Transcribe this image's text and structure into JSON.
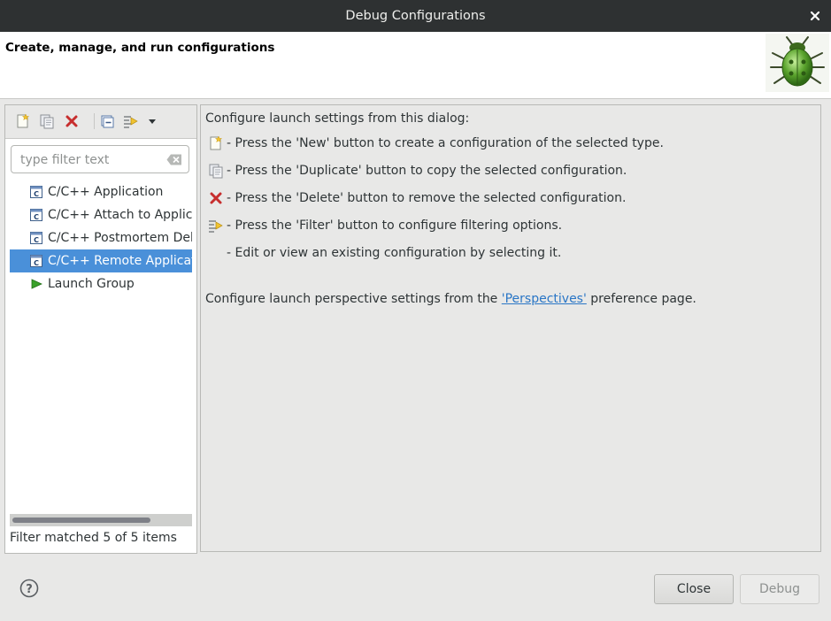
{
  "window": {
    "title": "Debug Configurations",
    "close_icon": "close-icon"
  },
  "banner": {
    "heading": "Create, manage, and run configurations",
    "logo_icon": "debug-bug-icon"
  },
  "left_panel": {
    "toolbar": [
      {
        "name": "new-configuration",
        "icon": "new-config-icon"
      },
      {
        "name": "duplicate-configuration",
        "icon": "duplicate-icon"
      },
      {
        "name": "delete-configuration",
        "icon": "delete-icon"
      },
      {
        "name": "collapse-all",
        "icon": "collapse-all-icon"
      },
      {
        "name": "filter-configurations",
        "icon": "filter-icon"
      },
      {
        "name": "filter-menu",
        "icon": "chevron-down-icon"
      }
    ],
    "filter": {
      "placeholder": "type filter text",
      "value": ""
    },
    "tree": [
      {
        "label": "C/C++ Application",
        "icon": "c-app-icon",
        "selected": false
      },
      {
        "label": "C/C++ Attach to Application",
        "icon": "c-app-icon",
        "selected": false
      },
      {
        "label": "C/C++ Postmortem Debugger",
        "icon": "c-app-icon",
        "selected": false
      },
      {
        "label": "C/C++ Remote Application",
        "icon": "c-app-icon",
        "selected": true
      },
      {
        "label": "Launch Group",
        "icon": "launch-group-icon",
        "selected": false
      }
    ],
    "status": "Filter matched 5 of 5 items"
  },
  "right_panel": {
    "intro": "Configure launch settings from this dialog:",
    "lines": [
      {
        "icon": "new-config-icon",
        "text": "- Press the 'New' button to create a configuration of the selected type."
      },
      {
        "icon": "duplicate-icon",
        "text": "- Press the 'Duplicate' button to copy the selected configuration."
      },
      {
        "icon": "delete-icon",
        "text": "- Press the 'Delete' button to remove the selected configuration."
      },
      {
        "icon": "filter-icon",
        "text": "- Press the 'Filter' button to configure filtering options."
      },
      {
        "icon": "",
        "text": "- Edit or view an existing configuration by selecting it."
      }
    ],
    "perspective_prefix": "Configure launch perspective settings from the ",
    "perspective_link": "'Perspectives'",
    "perspective_suffix": " preference page."
  },
  "footer": {
    "help_icon": "help-icon",
    "close_label": "Close",
    "debug_label": "Debug",
    "debug_enabled": false
  },
  "colors": {
    "selection": "#4a90d9",
    "link": "#2a76c6",
    "titlebar": "#2e3132"
  }
}
